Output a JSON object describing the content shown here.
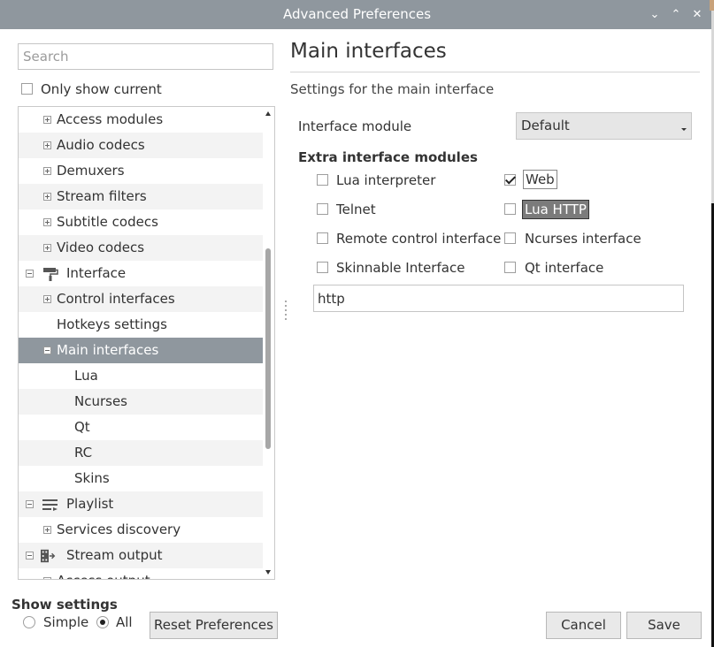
{
  "window": {
    "title": "Advanced Preferences"
  },
  "search": {
    "placeholder": "Search",
    "value": ""
  },
  "only_show_current": {
    "label": "Only show current",
    "checked": false
  },
  "tree": {
    "items": [
      {
        "label": "Access modules",
        "type": "plus",
        "selected": false
      },
      {
        "label": "Audio codecs",
        "type": "plus",
        "selected": false
      },
      {
        "label": "Demuxers",
        "type": "plus",
        "selected": false
      },
      {
        "label": "Stream filters",
        "type": "plus",
        "selected": false
      },
      {
        "label": "Subtitle codecs",
        "type": "plus",
        "selected": false
      },
      {
        "label": "Video codecs",
        "type": "plus",
        "selected": false
      },
      {
        "label": "Interface",
        "type": "minus",
        "icon": "paint-roller-icon",
        "selected": false
      },
      {
        "label": "Control interfaces",
        "type": "plus",
        "selected": false
      },
      {
        "label": "Hotkeys settings",
        "type": "none",
        "selected": false
      },
      {
        "label": "Main interfaces",
        "type": "minus",
        "selected": true
      },
      {
        "label": "Lua",
        "type": "child",
        "selected": false
      },
      {
        "label": "Ncurses",
        "type": "child",
        "selected": false
      },
      {
        "label": "Qt",
        "type": "child",
        "selected": false
      },
      {
        "label": "RC",
        "type": "child",
        "selected": false
      },
      {
        "label": "Skins",
        "type": "child",
        "selected": false
      },
      {
        "label": "Playlist",
        "type": "minus",
        "icon": "playlist-icon",
        "selected": false
      },
      {
        "label": "Services discovery",
        "type": "plus",
        "selected": false
      },
      {
        "label": "Stream output",
        "type": "minus",
        "icon": "stream-output-icon",
        "selected": false
      },
      {
        "label": "Access output",
        "type": "plus",
        "selected": false
      }
    ]
  },
  "main": {
    "title": "Main interfaces",
    "subtitle": "Settings for the main interface",
    "interface_module": {
      "label": "Interface module",
      "value": "Default"
    },
    "extra_modules": {
      "heading": "Extra interface modules",
      "options": [
        {
          "label": "Lua interpreter",
          "checked": false
        },
        {
          "label": "Web",
          "checked": true
        },
        {
          "label": "Telnet",
          "checked": false
        },
        {
          "label": "Lua HTTP",
          "checked": false
        },
        {
          "label": "Remote control interface",
          "checked": false
        },
        {
          "label": "Ncurses interface",
          "checked": false
        },
        {
          "label": "Skinnable Interface",
          "checked": false
        },
        {
          "label": "Qt interface",
          "checked": false
        }
      ],
      "text_value": "http"
    }
  },
  "footer": {
    "show_settings_label": "Show settings",
    "simple_label": "Simple",
    "all_label": "All",
    "selected_mode": "All",
    "reset_label": "Reset Preferences",
    "cancel_label": "Cancel",
    "save_label": "Save"
  }
}
